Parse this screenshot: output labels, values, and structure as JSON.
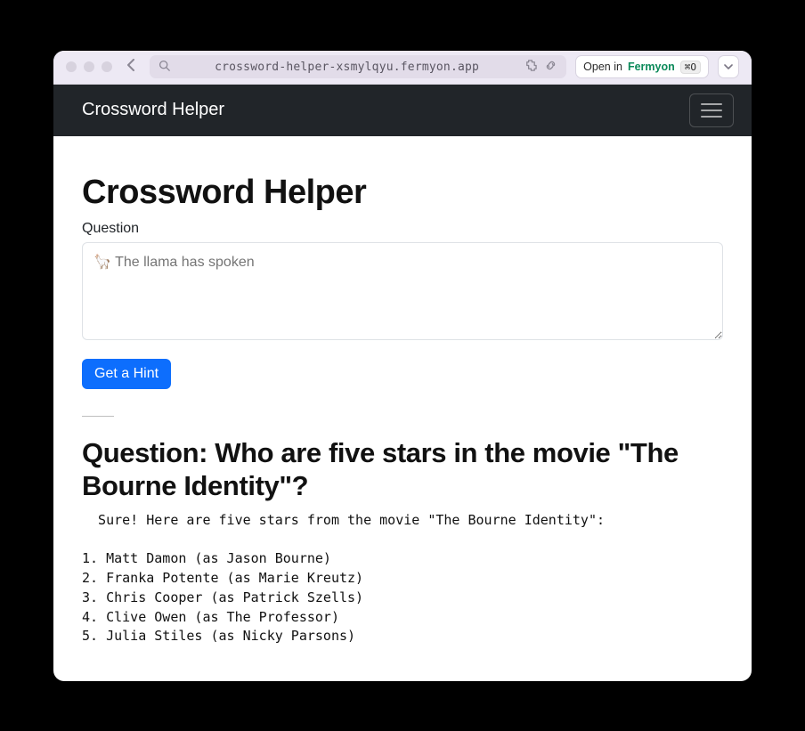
{
  "titlebar": {
    "url": "crossword-helper-xsmylqyu.fermyon.app",
    "open_in_prefix": "Open in",
    "open_in_brand": "Fermyon",
    "open_in_shortcut": "⌘O"
  },
  "navbar": {
    "brand": "Crossword Helper"
  },
  "page": {
    "heading": "Crossword Helper",
    "question_label": "Question",
    "question_placeholder": "🦙 The llama has spoken",
    "question_value": "",
    "hint_button": "Get a Hint",
    "result_heading": "Question: Who are five stars in the movie \"The Bourne Identity\"?",
    "answer_text": "  Sure! Here are five stars from the movie \"The Bourne Identity\":\n\n1. Matt Damon (as Jason Bourne)\n2. Franka Potente (as Marie Kreutz)\n3. Chris Cooper (as Patrick Szells)\n4. Clive Owen (as The Professor)\n5. Julia Stiles (as Nicky Parsons)"
  }
}
